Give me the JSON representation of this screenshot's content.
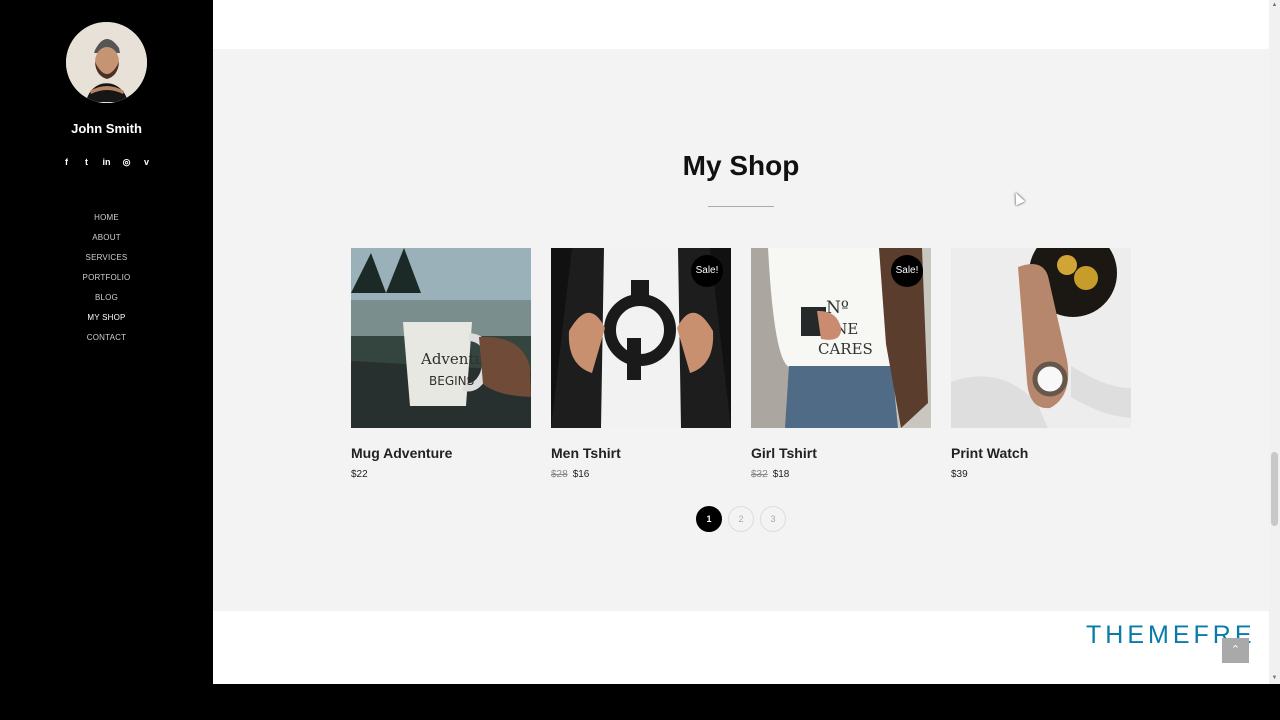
{
  "sidebar": {
    "name": "John Smith",
    "social": [
      "f",
      "t",
      "in",
      "◎",
      "v"
    ],
    "nav": [
      "HOME",
      "ABOUT",
      "SERVICES",
      "PORTFOLIO",
      "BLOG",
      "MY SHOP",
      "CONTACT"
    ]
  },
  "shop": {
    "title": "My Shop",
    "sale_label": "Sale!",
    "products": [
      {
        "name": "Mug Adventure",
        "price": "$22"
      },
      {
        "name": "Men Tshirt",
        "old": "$28",
        "price": "$16"
      },
      {
        "name": "Girl Tshirt",
        "old": "$32",
        "price": "$18"
      },
      {
        "name": "Print Watch",
        "price": "$39"
      }
    ],
    "pages": [
      "1",
      "2",
      "3"
    ]
  },
  "brand": "THEMEFRE",
  "back_to_top": "⌃"
}
